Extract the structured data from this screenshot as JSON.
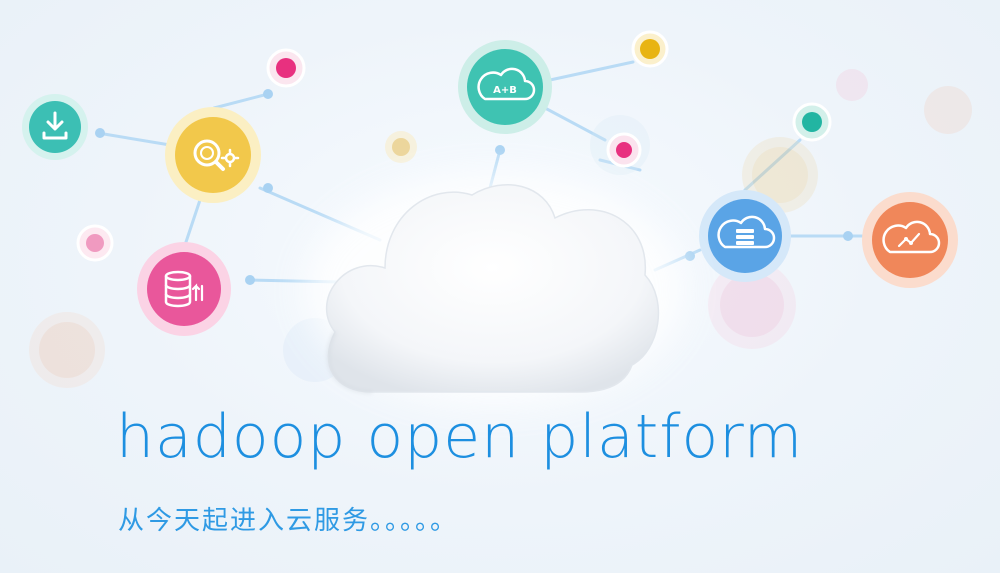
{
  "banner": {
    "title": "hadoop open platform",
    "subtitle": "从今天起进入云服务。。。。。"
  },
  "icons": {
    "download": {
      "name": "download-icon",
      "color": "#3cbfb4"
    },
    "search_settings": {
      "name": "search-settings-icon",
      "color": "#f2c84b"
    },
    "database": {
      "name": "database-icon",
      "color": "#e9579b"
    },
    "cloud_ab": {
      "name": "cloud-ab-icon",
      "label": "A+B",
      "color": "#3fc3b2"
    },
    "cloud_server": {
      "name": "cloud-server-icon",
      "color": "#5aa4e6"
    },
    "cloud_chart": {
      "name": "cloud-chart-icon",
      "color": "#f0875a"
    }
  },
  "colors": {
    "headline": "#1d8fe0",
    "line": "#b9dbf5",
    "dot_pink": "#e8307f",
    "dot_yellow": "#e8b413",
    "dot_teal": "#22b5a2"
  }
}
